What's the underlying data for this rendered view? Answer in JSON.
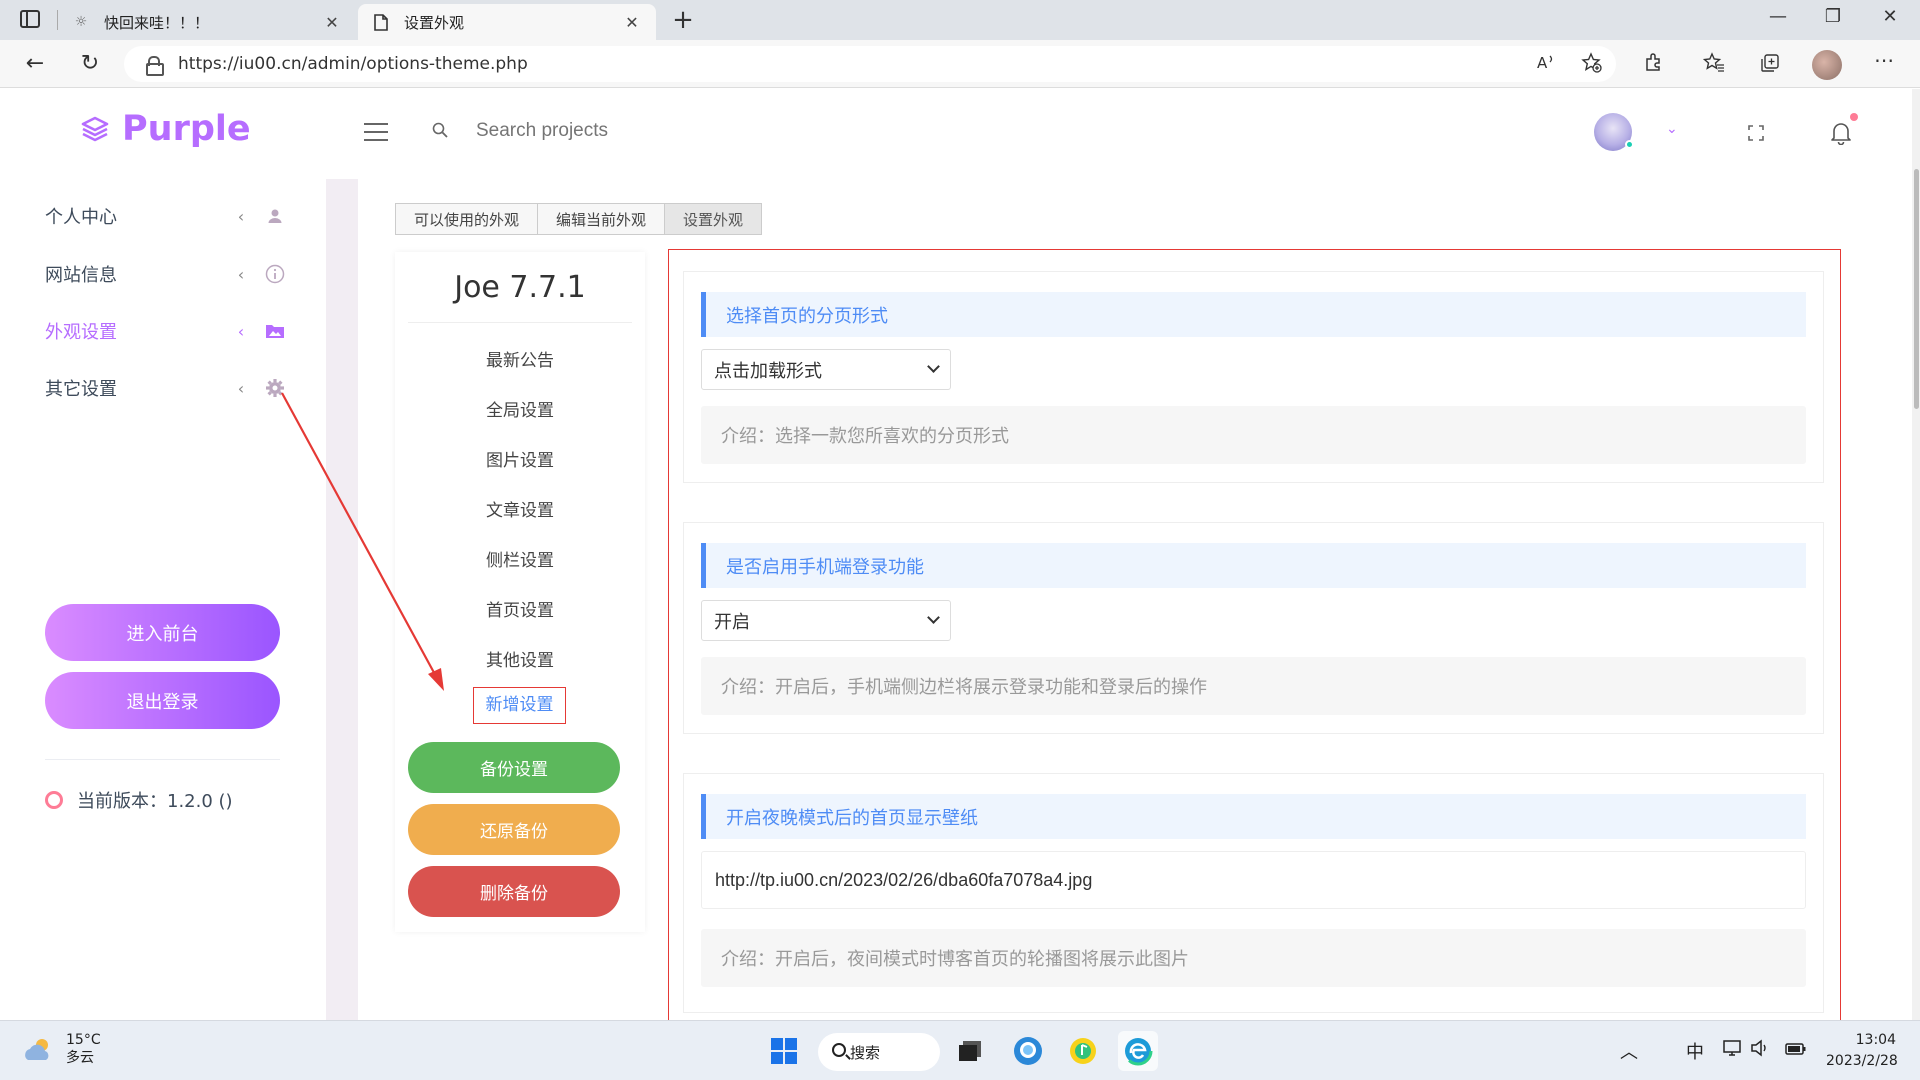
{
  "browser": {
    "tabs": [
      {
        "title": "快回来哇！！！",
        "icon": "gear-icon",
        "active": false
      },
      {
        "title": "设置外观",
        "icon": "document-icon",
        "active": true
      }
    ],
    "close_glyph": "✕",
    "new_tab_glyph": "+",
    "window_controls": {
      "minimize": "—",
      "restore": "❐",
      "close": "✕"
    },
    "url": "https://iu00.cn/admin/options-theme.php",
    "nav": {
      "back": "←",
      "reload": "↻"
    },
    "toolbar_icons": [
      "read-aloud-icon",
      "favorite-add-icon",
      "extensions-icon",
      "favorites-icon",
      "collections-icon",
      "profile-avatar",
      "more-icon"
    ]
  },
  "header": {
    "logo_text": "Purple",
    "search_placeholder": "Search projects",
    "user_caret": "⌄"
  },
  "sidebar": {
    "items": [
      {
        "label": "个人中心",
        "icon": "user-icon",
        "active": false
      },
      {
        "label": "网站信息",
        "icon": "info-icon",
        "active": false
      },
      {
        "label": "外观设置",
        "icon": "image-folder-icon",
        "active": true
      },
      {
        "label": "其它设置",
        "icon": "gear-icon",
        "active": false
      }
    ],
    "chevron": "‹",
    "buttons": {
      "frontend": "进入前台",
      "logout": "退出登录"
    },
    "version": "当前版本：1.2.0 ()"
  },
  "theme_tabs": [
    "可以使用的外观",
    "编辑当前外观",
    "设置外观"
  ],
  "options_panel": {
    "title": "Joe 7.7.1",
    "items": [
      "最新公告",
      "全局设置",
      "图片设置",
      "文章设置",
      "侧栏设置",
      "首页设置",
      "其他设置",
      "新增设置"
    ],
    "buttons": {
      "backup": "备份设置",
      "restore": "还原备份",
      "delete": "删除备份"
    }
  },
  "settings": [
    {
      "title": "选择首页的分页形式",
      "type": "select",
      "value": "点击加载形式",
      "desc": "介绍：选择一款您所喜欢的分页形式"
    },
    {
      "title": "是否启用手机端登录功能",
      "type": "select",
      "value": "开启",
      "desc": "介绍：开启后，手机端侧边栏将展示登录功能和登录后的操作"
    },
    {
      "title": "开启夜晚模式后的首页显示壁纸",
      "type": "text",
      "value": "http://tp.iu00.cn/2023/02/26/dba60fa7078a4.jpg",
      "desc": "介绍：开启后，夜间模式时博客首页的轮播图将展示此图片"
    }
  ],
  "colors": {
    "brand": "#b66dff",
    "accent_blue": "#4e8cf5",
    "backup_green": "#5cb85c",
    "restore_orange": "#f0ad4e",
    "delete_red": "#d9534f",
    "annotation_red": "#e53935"
  },
  "taskbar": {
    "weather_temp": "15°C",
    "weather_desc": "多云",
    "search_label": "搜索",
    "ime": "中",
    "tray_up": "︿",
    "time": "13:04",
    "date": "2023/2/28",
    "apps": [
      "windows-start-icon",
      "search",
      "task-view-icon",
      "messenger-icon",
      "music-app-icon",
      "edge-icon"
    ]
  }
}
